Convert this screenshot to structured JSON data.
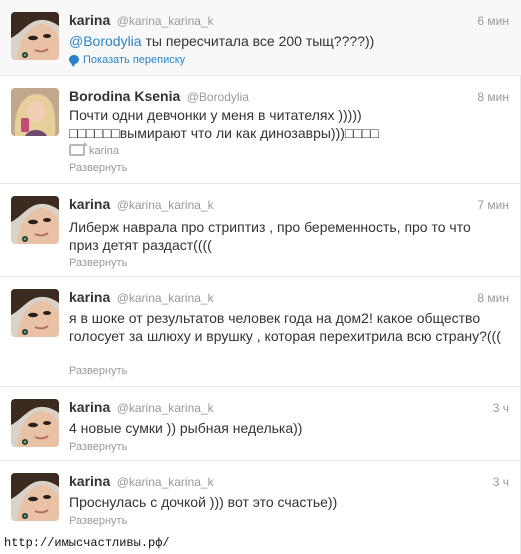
{
  "tweets": [
    {
      "name": "karina",
      "handle": "@karina_karina_k",
      "time": "6 мин",
      "mention": "@Borodylia",
      "text": " ты пересчитала все 200 тыщ????))",
      "action": "Показать переписку",
      "avatar_icon": "karina-avatar"
    },
    {
      "name": "Borodina Ksenia",
      "handle": "@Borodylia",
      "time": "8 мин",
      "text": "Почти одни девчонки у меня в читателях ))))) □□□□□□вымирают что ли как динозавры)))□□□□",
      "retweet_label": "karina",
      "action": "Развернуть",
      "avatar_icon": "borodina-avatar"
    },
    {
      "name": "karina",
      "handle": "@karina_karina_k",
      "time": "7 мин",
      "text": "Либерж наврала про стриптиз , про беременность, про то что приз детят раздаст((((",
      "action": "Развернуть",
      "avatar_icon": "karina-avatar"
    },
    {
      "name": "karina",
      "handle": "@karina_karina_k",
      "time": "8 мин",
      "text": "я в шоке от результатов человек года на дом2! какое общество голосует за шлюху и врушку , которая перехитрила всю страну?(((",
      "action": "Развернуть",
      "avatar_icon": "karina-avatar"
    },
    {
      "name": "karina",
      "handle": "@karina_karina_k",
      "time": "3 ч",
      "text": "4 новые сумки )) рыбная неделька))",
      "action": "Развернуть",
      "avatar_icon": "karina-avatar"
    },
    {
      "name": "karina",
      "handle": "@karina_karina_k",
      "time": "3 ч",
      "text": "Проснулась с дочкой ))) вот это счастье))",
      "action": "Развернуть",
      "avatar_icon": "karina-avatar"
    }
  ],
  "watermark": "http://имысчастливы.рф/",
  "colors": {
    "link": "#2a84c7",
    "muted": "#999999",
    "text": "#333333",
    "divider": "#e8e8e8"
  }
}
